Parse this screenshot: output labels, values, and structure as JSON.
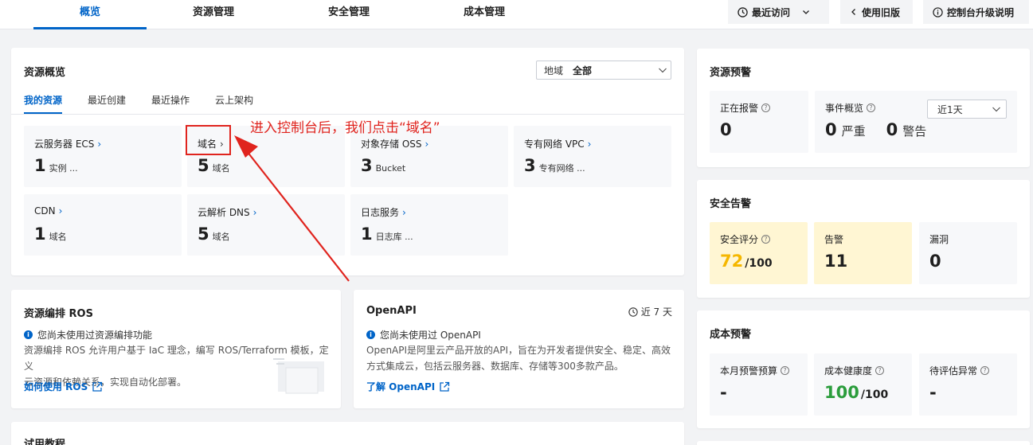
{
  "nav": {
    "tabs": [
      {
        "label": "概览",
        "active": true
      },
      {
        "label": "资源管理",
        "active": false
      },
      {
        "label": "安全管理",
        "active": false
      },
      {
        "label": "成本管理",
        "active": false
      }
    ],
    "recent_label": "最近访问",
    "old_version_label": "使用旧版",
    "upgrade_label": "控制台升级说明"
  },
  "overview": {
    "title": "资源概览",
    "region_label": "地域",
    "region_value": "全部",
    "subtabs": [
      "我的资源",
      "最近创建",
      "最近操作",
      "云上架构"
    ],
    "tiles": [
      {
        "name": "云服务器 ECS",
        "count": "1",
        "unit": "实例 ..."
      },
      {
        "name": "域名",
        "count": "5",
        "unit": "域名"
      },
      {
        "name": "对象存储 OSS",
        "count": "3",
        "unit": "Bucket"
      },
      {
        "name": "专有网络 VPC",
        "count": "3",
        "unit": "专有网络 ..."
      },
      {
        "name": "CDN",
        "count": "1",
        "unit": "域名"
      },
      {
        "name": "云解析 DNS",
        "count": "5",
        "unit": "域名"
      },
      {
        "name": "日志服务",
        "count": "1",
        "unit": "日志库 ..."
      }
    ]
  },
  "annotation": {
    "text": "进入控制台后，我们点击“域名”"
  },
  "ros": {
    "title": "资源编排 ROS",
    "notice": "您尚未使用过资源编排功能",
    "desc_line1": "资源编排 ROS 允许用户基于 IaC 理念，编写 ROS/Terraform 模板，定义",
    "desc_line2": "云资源和依赖关系，实现自动化部署。",
    "link": "如何使用 ROS"
  },
  "openapi": {
    "title": "OpenAPI",
    "period": "近 7 天",
    "notice": "您尚未使用过 OpenAPI",
    "desc_line1": "OpenAPI是阿里云产品开放的API，旨在为开发者提供安全、稳定、高效",
    "desc_line2": "方式集成云，包括云服务器、数据库、存储等300多款产品。",
    "link": "了解 OpenAPI"
  },
  "tutorial": {
    "title": "试用教程"
  },
  "alerts": {
    "title": "资源预警",
    "firing_label": "正在报警",
    "firing_value": "0",
    "events_label": "事件概览",
    "period_value": "近1天",
    "serious_value": "0",
    "serious_label": "严重",
    "warning_value": "0",
    "warning_label": "警告"
  },
  "security": {
    "title": "安全告警",
    "score_label": "安全评分",
    "score_value": "72",
    "score_total": "/100",
    "alarm_label": "告警",
    "alarm_value": "11",
    "vuln_label": "漏洞",
    "vuln_value": "0"
  },
  "cost": {
    "title": "成本预警",
    "budget_label": "本月预警预算",
    "budget_value": "-",
    "health_label": "成本健康度",
    "health_value": "100",
    "health_total": "/100",
    "anomaly_label": "待评估异常",
    "anomaly_value": "-"
  },
  "colors": {
    "accent": "#0064c8",
    "annotation": "#e0241e",
    "score_yellow": "#f5b700",
    "health_green": "#2b9d3c",
    "warn_bg": "#fff6d3"
  }
}
